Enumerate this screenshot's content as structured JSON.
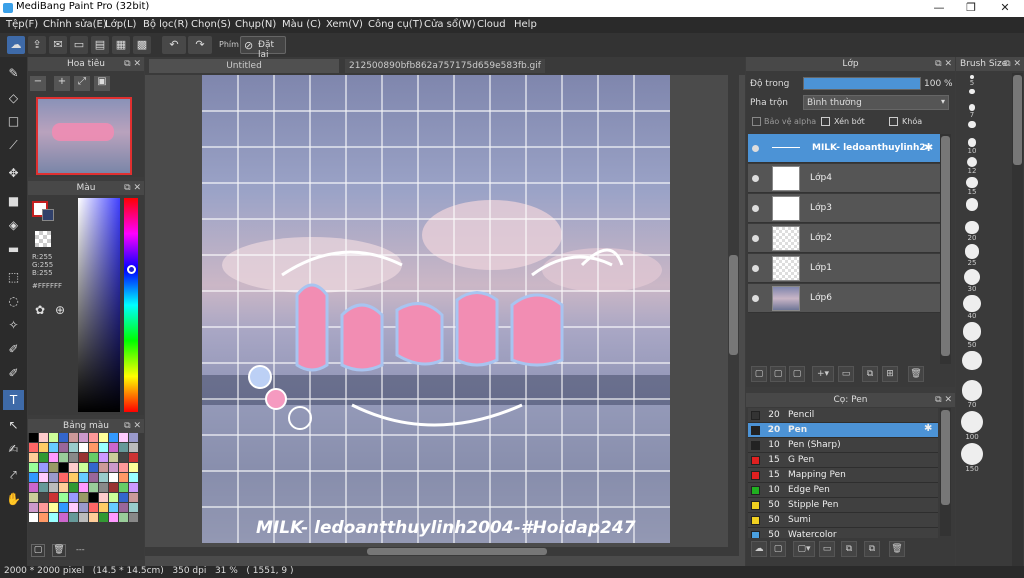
{
  "window": {
    "title": "MediBang Paint Pro (32bit)",
    "minimize": "—",
    "maximize": "❐",
    "close": "✕"
  },
  "menu": [
    "Tệp(F)",
    "Chỉnh sửa(E)",
    "Lớp(L)",
    "Bộ lọc(R)",
    "Chọn(S)",
    "Chụp(N)",
    "Màu (C)",
    "Xem(V)",
    "Công cụ(T)",
    "Cửa sổ(W)",
    "Cloud",
    "Help"
  ],
  "toolbar": {
    "phim_label": "Phím",
    "reset_label": "Đặt lại"
  },
  "navigator": {
    "title": "Hoa tiêu"
  },
  "color_panel": {
    "title": "Màu",
    "r": "R:255",
    "g": "G:255",
    "b": "B:255",
    "hex": "#FFFFFF"
  },
  "palette_panel": {
    "title": "Bảng màu",
    "footer_text": "---"
  },
  "tabs": [
    "Untitled",
    "212500890bfb862a757175d659e583fb.gif"
  ],
  "canvas": {
    "watermark": "MILK- ledoantthuylinh2004-#Hoidap247"
  },
  "layers": {
    "title": "Lớp",
    "opacity_label": "Độ trong",
    "opacity_value": "100 %",
    "blend_label": "Pha trộn",
    "blend_value": "Bình thường",
    "alpha_label": "Bảo vệ alpha",
    "clip_label": "Xén bớt",
    "lock_label": "Khóa",
    "items": [
      "MILK- ledoanthuylinh2",
      "Lớp4",
      "Lớp3",
      "Lớp2",
      "Lớp1",
      "Lớp6"
    ]
  },
  "brush_panel": {
    "title": "Cọ: Pen",
    "items": [
      {
        "size": "20",
        "name": "Pencil"
      },
      {
        "size": "20",
        "name": "Pen"
      },
      {
        "size": "10",
        "name": "Pen (Sharp)"
      },
      {
        "size": "15",
        "name": "G Pen"
      },
      {
        "size": "15",
        "name": "Mapping Pen"
      },
      {
        "size": "10",
        "name": "Edge Pen"
      },
      {
        "size": "50",
        "name": "Stipple Pen"
      },
      {
        "size": "50",
        "name": "Sumi"
      },
      {
        "size": "50",
        "name": "Watercolor"
      }
    ],
    "swatch_colors": [
      "#333333",
      "#222222",
      "#222222",
      "#e02020",
      "#e02020",
      "#20b020",
      "#f0d020",
      "#f0d020",
      "#4aa0e0"
    ]
  },
  "brush_size": {
    "title": "Brush Size",
    "sizes": [
      "5",
      "",
      "7",
      "",
      "10",
      "12",
      "15",
      "",
      "20",
      "25",
      "30",
      "40",
      "50",
      "",
      "70",
      "100",
      "150"
    ]
  },
  "status": {
    "text": "2000 * 2000 pixel   (14.5 * 14.5cm)   350 dpi   31 %   ( 1551, 9 )"
  },
  "accent_color": "#4c93d6"
}
